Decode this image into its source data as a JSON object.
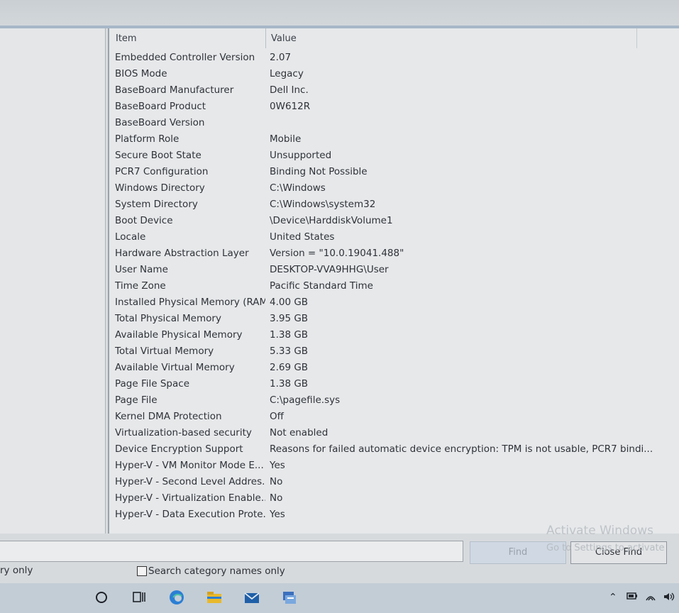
{
  "list": {
    "columns": [
      "Item",
      "Value"
    ],
    "rows": [
      {
        "item": "Embedded Controller Version",
        "value": "2.07"
      },
      {
        "item": "BIOS Mode",
        "value": "Legacy"
      },
      {
        "item": "BaseBoard Manufacturer",
        "value": "Dell Inc."
      },
      {
        "item": "BaseBoard Product",
        "value": "0W612R"
      },
      {
        "item": "BaseBoard Version",
        "value": ""
      },
      {
        "item": "Platform Role",
        "value": "Mobile"
      },
      {
        "item": "Secure Boot State",
        "value": "Unsupported"
      },
      {
        "item": "PCR7 Configuration",
        "value": "Binding Not Possible"
      },
      {
        "item": "Windows Directory",
        "value": "C:\\Windows"
      },
      {
        "item": "System Directory",
        "value": "C:\\Windows\\system32"
      },
      {
        "item": "Boot Device",
        "value": "\\Device\\HarddiskVolume1"
      },
      {
        "item": "Locale",
        "value": "United States"
      },
      {
        "item": "Hardware Abstraction Layer",
        "value": "Version = \"10.0.19041.488\""
      },
      {
        "item": "User Name",
        "value": "DESKTOP-VVA9HHG\\User"
      },
      {
        "item": "Time Zone",
        "value": "Pacific Standard Time"
      },
      {
        "item": "Installed Physical Memory (RAM)",
        "value": "4.00 GB"
      },
      {
        "item": "Total Physical Memory",
        "value": "3.95 GB"
      },
      {
        "item": "Available Physical Memory",
        "value": "1.38 GB"
      },
      {
        "item": "Total Virtual Memory",
        "value": "5.33 GB"
      },
      {
        "item": "Available Virtual Memory",
        "value": "2.69 GB"
      },
      {
        "item": "Page File Space",
        "value": "1.38 GB"
      },
      {
        "item": "Page File",
        "value": "C:\\pagefile.sys"
      },
      {
        "item": "Kernel DMA Protection",
        "value": "Off"
      },
      {
        "item": "Virtualization-based security",
        "value": "Not enabled"
      },
      {
        "item": "Device Encryption Support",
        "value": "Reasons for failed automatic device encryption: TPM is not usable, PCR7 bindi..."
      },
      {
        "item": "Hyper-V - VM Monitor Mode E...",
        "value": "Yes"
      },
      {
        "item": "Hyper-V - Second Level Addres...",
        "value": "No"
      },
      {
        "item": "Hyper-V - Virtualization Enable...",
        "value": "No"
      },
      {
        "item": "Hyper-V - Data Execution Prote...",
        "value": "Yes"
      }
    ]
  },
  "find": {
    "find_label": "Find",
    "close_find_label": "Close Find",
    "search_only_partial": "ry only",
    "search_category_label": "Search category names only"
  },
  "watermark": {
    "line1": "Activate Windows",
    "line2": "Go to Settings to activate"
  },
  "taskbar": {
    "icons": [
      "search-circle-icon",
      "task-view-icon",
      "edge-icon",
      "file-explorer-icon",
      "mail-icon",
      "system-info-icon"
    ],
    "tray_icons": [
      "chevron-up-icon",
      "battery-icon",
      "wifi-icon",
      "speaker-icon"
    ]
  },
  "colors": {
    "taskbar": "#c3cdd6",
    "edge_blue": "#2b7fd4",
    "explorer_yellow": "#e9b92c"
  }
}
